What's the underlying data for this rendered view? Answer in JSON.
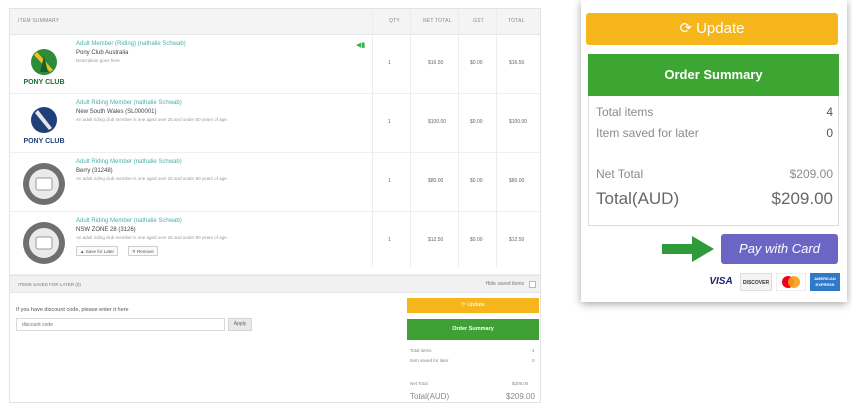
{
  "cart": {
    "header": {
      "item_summary": "ITEM SUMMARY",
      "qty": "QTY",
      "net_total": "NET TOTAL",
      "gst": "GST",
      "total": "TOTAL"
    },
    "items": [
      {
        "title": "Adult Member (Riding) (nathalie Schwab)",
        "club": "Pony Club Australia",
        "desc": "Description goes here",
        "qty": "1",
        "net": "$16.50",
        "gst": "$0.00",
        "total": "$16.50",
        "logo": "pony-club-australia-logo"
      },
      {
        "title": "Adult Riding Member (nathalie Schwab)",
        "club": "New South Wales (SL000001)",
        "desc": "An adult riding club member is one aged over 25 and under 80 years of age.",
        "qty": "1",
        "net": "$100.00",
        "gst": "$0.00",
        "total": "$100.00",
        "logo": "pony-club-nsw-logo"
      },
      {
        "title": "Adult Riding Member (nathalie Schwab)",
        "club": "Berry (31248)",
        "desc": "An adult riding club member is one aged over 25 and under 80 years of age.",
        "qty": "1",
        "net": "$80.00",
        "gst": "$0.00",
        "total": "$80.00",
        "logo": "club-placeholder-logo"
      },
      {
        "title": "Adult Riding Member (nathalie Schwab)",
        "club": "NSW ZONE 28 (3126)",
        "desc": "An adult riding club member is one aged over 25 and under 80 years of age.",
        "qty": "1",
        "net": "$12.50",
        "gst": "$0.00",
        "total": "$12.50",
        "logo": "club-placeholder-logo",
        "save_for_later": "Save for Later",
        "remove": "Remove"
      }
    ],
    "saved_for_later": {
      "label": "ITEMS SAVED FOR LATER (0)",
      "hide_label": "Hide saved items"
    },
    "discount": {
      "prompt": "If you have discount code, please enter it here",
      "placeholder": "discount code",
      "apply": "Apply"
    },
    "summary_small": {
      "update": "Update",
      "order_summary": "Order Summary",
      "total_items_label": "Total items",
      "total_items": "4",
      "saved_label": "Item saved for later",
      "saved": "0",
      "net_label": "Net Total",
      "net": "$209.00",
      "total_label": "Total(AUD)",
      "total": "$209.00"
    }
  },
  "summary": {
    "update_label": "Update",
    "order_summary": "Order Summary",
    "total_items_label": "Total items",
    "total_items": "4",
    "saved_label": "Item saved for later",
    "saved": "0",
    "net_label": "Net Total",
    "net": "$209.00",
    "total_label": "Total(AUD)",
    "total": "$209.00",
    "pay_label": "Pay with Card",
    "cards": [
      "VISA",
      "DISCOVER",
      "MasterCard",
      "AMERICAN EXPRESS"
    ]
  },
  "colors": {
    "update": "#f7b51c",
    "order": "#3da632",
    "pay": "#6b65c6",
    "arrow": "#2e9a3a"
  }
}
